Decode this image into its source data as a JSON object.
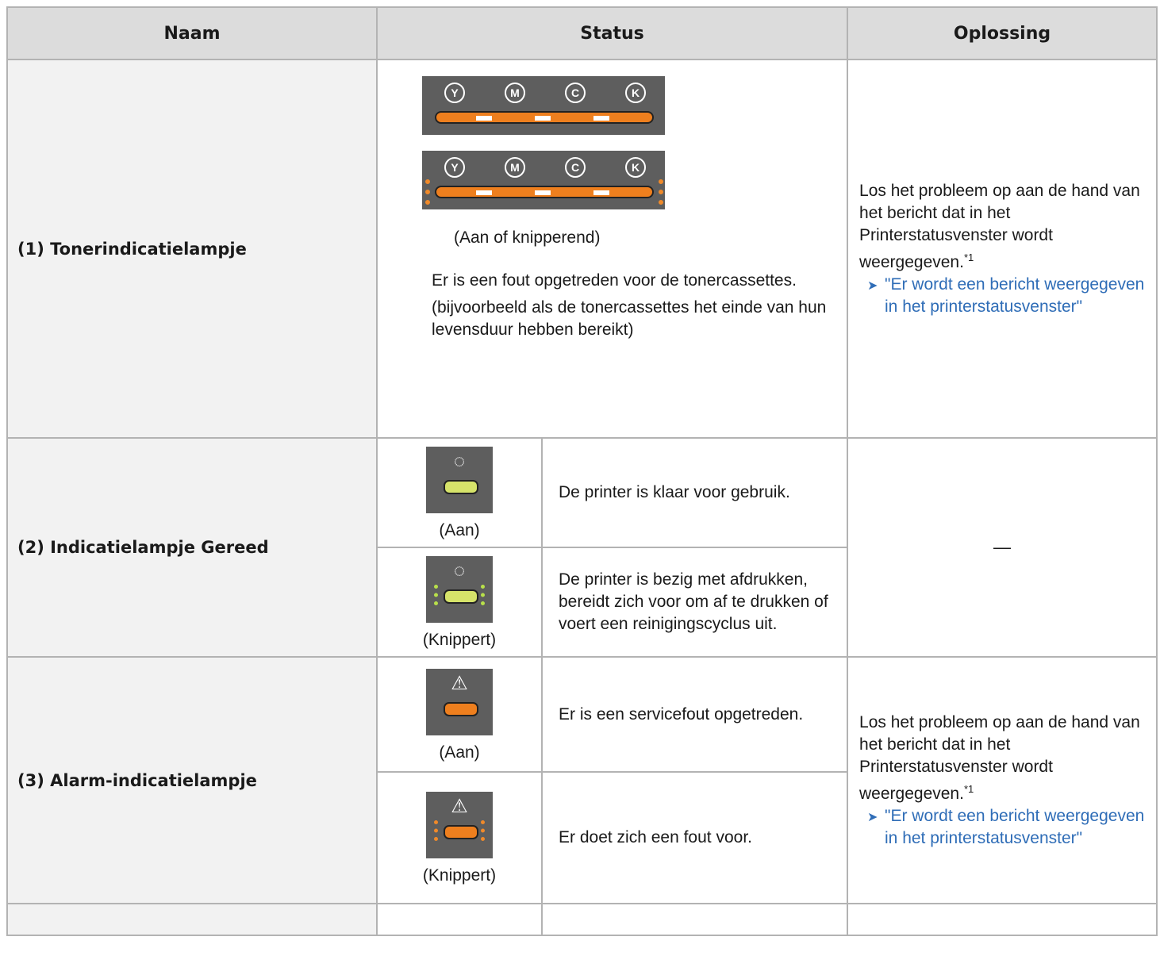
{
  "headers": {
    "name": "Naam",
    "status": "Status",
    "solution": "Oplossing"
  },
  "rows": [
    {
      "name": "(1) Tonerindicatielampje",
      "toner_letters": [
        "Y",
        "M",
        "C",
        "K"
      ],
      "caption": "(Aan of knipperend)",
      "desc1": "Er is een fout opgetreden voor de tonercassettes.",
      "desc2": "(bijvoorbeeld als de tonercassettes het einde van hun levensduur hebben bereikt)",
      "solution_text": "Los het probleem op aan de hand van het bericht dat in het Printerstatusvenster wordt weergegeven.",
      "footnote": "*1",
      "link": "\"Er wordt een bericht weergegeven in het printerstatusvenster\""
    },
    {
      "name": "(2) Indicatielampje Gereed",
      "states": [
        {
          "icon": "power-icon",
          "caption": "(Aan)",
          "message": "De printer is klaar voor gebruik."
        },
        {
          "icon": "power-icon",
          "caption": "(Knippert)",
          "message": "De printer is bezig met afdrukken, bereidt zich voor om af te drukken of voert een reinigingscyclus uit."
        }
      ],
      "solution_text": "—"
    },
    {
      "name": "(3) Alarm-indicatielampje",
      "states": [
        {
          "icon": "warning-icon",
          "caption": "(Aan)",
          "message": "Er is een servicefout opgetreden."
        },
        {
          "icon": "warning-icon",
          "caption": "(Knippert)",
          "message": "Er doet zich een fout voor."
        }
      ],
      "solution_text": "Los het probleem op aan de hand van het bericht dat in het Printerstatusvenster wordt weergegeven.",
      "footnote": "*1",
      "link": "\"Er wordt een bericht weergegeven in het printerstatusvenster\""
    }
  ],
  "colors": {
    "header_bg": "#dcdcdc",
    "name_bg": "#f2f2f2",
    "link": "#2f6db7",
    "orange": "#ee7f1e",
    "ready_green": "#d6e36a"
  }
}
